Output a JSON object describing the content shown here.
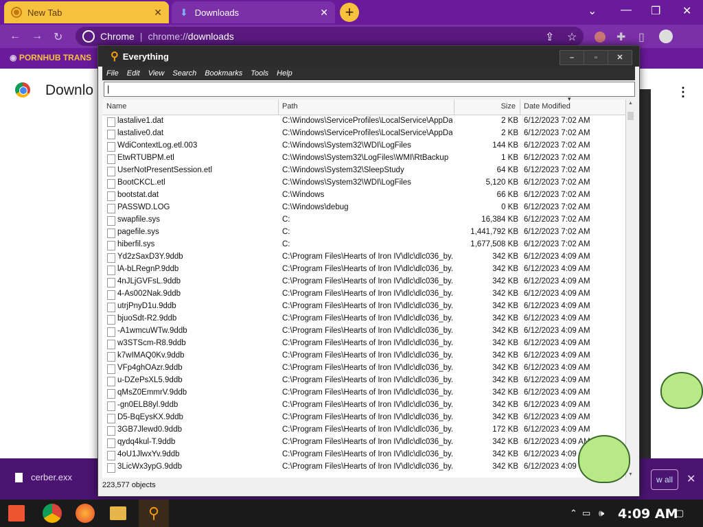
{
  "browser": {
    "tabs": [
      {
        "label": "New Tab"
      },
      {
        "label": "Downloads"
      }
    ],
    "new_tab_symbol": "+",
    "omnibox": {
      "site_label": "Chrome",
      "url_prefix": "chrome://",
      "url_path": "downloads"
    },
    "bookmark": "PORNHUB TRANS",
    "page_title": "Downlo",
    "window_controls": [
      "⌄",
      "—",
      "❐",
      "✕"
    ]
  },
  "download_shelf": {
    "file_name": "cerber.exx",
    "show_all_label": "w all"
  },
  "everything": {
    "title": "Everything",
    "menu": [
      "File",
      "Edit",
      "View",
      "Search",
      "Bookmarks",
      "Tools",
      "Help"
    ],
    "search_value": "|",
    "columns": {
      "name": "Name",
      "path": "Path",
      "size": "Size",
      "date": "Date Modified"
    },
    "rows": [
      {
        "name": "lastalive1.dat",
        "path": "C:\\Windows\\ServiceProfiles\\LocalService\\AppDat...",
        "size": "2 KB",
        "date": "6/12/2023 7:02 AM"
      },
      {
        "name": "lastalive0.dat",
        "path": "C:\\Windows\\ServiceProfiles\\LocalService\\AppDat...",
        "size": "2 KB",
        "date": "6/12/2023 7:02 AM"
      },
      {
        "name": "WdiContextLog.etl.003",
        "path": "C:\\Windows\\System32\\WDI\\LogFiles",
        "size": "144 KB",
        "date": "6/12/2023 7:02 AM"
      },
      {
        "name": "EtwRTUBPM.etl",
        "path": "C:\\Windows\\System32\\LogFiles\\WMI\\RtBackup",
        "size": "1 KB",
        "date": "6/12/2023 7:02 AM"
      },
      {
        "name": "UserNotPresentSession.etl",
        "path": "C:\\Windows\\System32\\SleepStudy",
        "size": "64 KB",
        "date": "6/12/2023 7:02 AM"
      },
      {
        "name": "BootCKCL.etl",
        "path": "C:\\Windows\\System32\\WDI\\LogFiles",
        "size": "5,120 KB",
        "date": "6/12/2023 7:02 AM"
      },
      {
        "name": "bootstat.dat",
        "path": "C:\\Windows",
        "size": "66 KB",
        "date": "6/12/2023 7:02 AM"
      },
      {
        "name": "PASSWD.LOG",
        "path": "C:\\Windows\\debug",
        "size": "0 KB",
        "date": "6/12/2023 7:02 AM"
      },
      {
        "name": "swapfile.sys",
        "path": "C:",
        "size": "16,384 KB",
        "date": "6/12/2023 7:02 AM"
      },
      {
        "name": "pagefile.sys",
        "path": "C:",
        "size": "1,441,792 KB",
        "date": "6/12/2023 7:02 AM"
      },
      {
        "name": "hiberfil.sys",
        "path": "C:",
        "size": "1,677,508 KB",
        "date": "6/12/2023 7:02 AM"
      },
      {
        "name": "Yd2zSaxD3Y.9ddb",
        "path": "C:\\Program Files\\Hearts of Iron IV\\dlc\\dlc036_by...",
        "size": "342 KB",
        "date": "6/12/2023 4:09 AM"
      },
      {
        "name": "lA-bLRegnP.9ddb",
        "path": "C:\\Program Files\\Hearts of Iron IV\\dlc\\dlc036_by...",
        "size": "342 KB",
        "date": "6/12/2023 4:09 AM"
      },
      {
        "name": "4nJLjGVFsL.9ddb",
        "path": "C:\\Program Files\\Hearts of Iron IV\\dlc\\dlc036_by...",
        "size": "342 KB",
        "date": "6/12/2023 4:09 AM"
      },
      {
        "name": "4-As002Nak.9ddb",
        "path": "C:\\Program Files\\Hearts of Iron IV\\dlc\\dlc036_by...",
        "size": "342 KB",
        "date": "6/12/2023 4:09 AM"
      },
      {
        "name": "utrjPnyD1u.9ddb",
        "path": "C:\\Program Files\\Hearts of Iron IV\\dlc\\dlc036_by...",
        "size": "342 KB",
        "date": "6/12/2023 4:09 AM"
      },
      {
        "name": "bjuoSdt-R2.9ddb",
        "path": "C:\\Program Files\\Hearts of Iron IV\\dlc\\dlc036_by...",
        "size": "342 KB",
        "date": "6/12/2023 4:09 AM"
      },
      {
        "name": "-A1wmcuWTw.9ddb",
        "path": "C:\\Program Files\\Hearts of Iron IV\\dlc\\dlc036_by...",
        "size": "342 KB",
        "date": "6/12/2023 4:09 AM"
      },
      {
        "name": "w3STScm-R8.9ddb",
        "path": "C:\\Program Files\\Hearts of Iron IV\\dlc\\dlc036_by...",
        "size": "342 KB",
        "date": "6/12/2023 4:09 AM"
      },
      {
        "name": "k7wIMAQ0Kv.9ddb",
        "path": "C:\\Program Files\\Hearts of Iron IV\\dlc\\dlc036_by...",
        "size": "342 KB",
        "date": "6/12/2023 4:09 AM"
      },
      {
        "name": "VFp4ghOAzr.9ddb",
        "path": "C:\\Program Files\\Hearts of Iron IV\\dlc\\dlc036_by...",
        "size": "342 KB",
        "date": "6/12/2023 4:09 AM"
      },
      {
        "name": "u-DZePsXL5.9ddb",
        "path": "C:\\Program Files\\Hearts of Iron IV\\dlc\\dlc036_by...",
        "size": "342 KB",
        "date": "6/12/2023 4:09 AM"
      },
      {
        "name": "qMsZ0EmmrV.9ddb",
        "path": "C:\\Program Files\\Hearts of Iron IV\\dlc\\dlc036_by...",
        "size": "342 KB",
        "date": "6/12/2023 4:09 AM"
      },
      {
        "name": "-gn0ELB8yl.9ddb",
        "path": "C:\\Program Files\\Hearts of Iron IV\\dlc\\dlc036_by...",
        "size": "342 KB",
        "date": "6/12/2023 4:09 AM"
      },
      {
        "name": "D5-BqEysKX.9ddb",
        "path": "C:\\Program Files\\Hearts of Iron IV\\dlc\\dlc036_by...",
        "size": "342 KB",
        "date": "6/12/2023 4:09 AM"
      },
      {
        "name": "3GB7Jlewd0.9ddb",
        "path": "C:\\Program Files\\Hearts of Iron IV\\dlc\\dlc036_by...",
        "size": "172 KB",
        "date": "6/12/2023 4:09 AM"
      },
      {
        "name": "qydq4kul-T.9ddb",
        "path": "C:\\Program Files\\Hearts of Iron IV\\dlc\\dlc036_by...",
        "size": "342 KB",
        "date": "6/12/2023 4:09 AM"
      },
      {
        "name": "4oU1JlwxYv.9ddb",
        "path": "C:\\Program Files\\Hearts of Iron IV\\dlc\\dlc036_by...",
        "size": "342 KB",
        "date": "6/12/2023 4:09"
      },
      {
        "name": "3LicWx3ypG.9ddb",
        "path": "C:\\Program Files\\Hearts of Iron IV\\dlc\\dlc036_by...",
        "size": "342 KB",
        "date": "6/12/2023 4:09"
      }
    ],
    "status": "223,577 objects"
  },
  "taskbar": {
    "clock": "4:09 AM"
  }
}
